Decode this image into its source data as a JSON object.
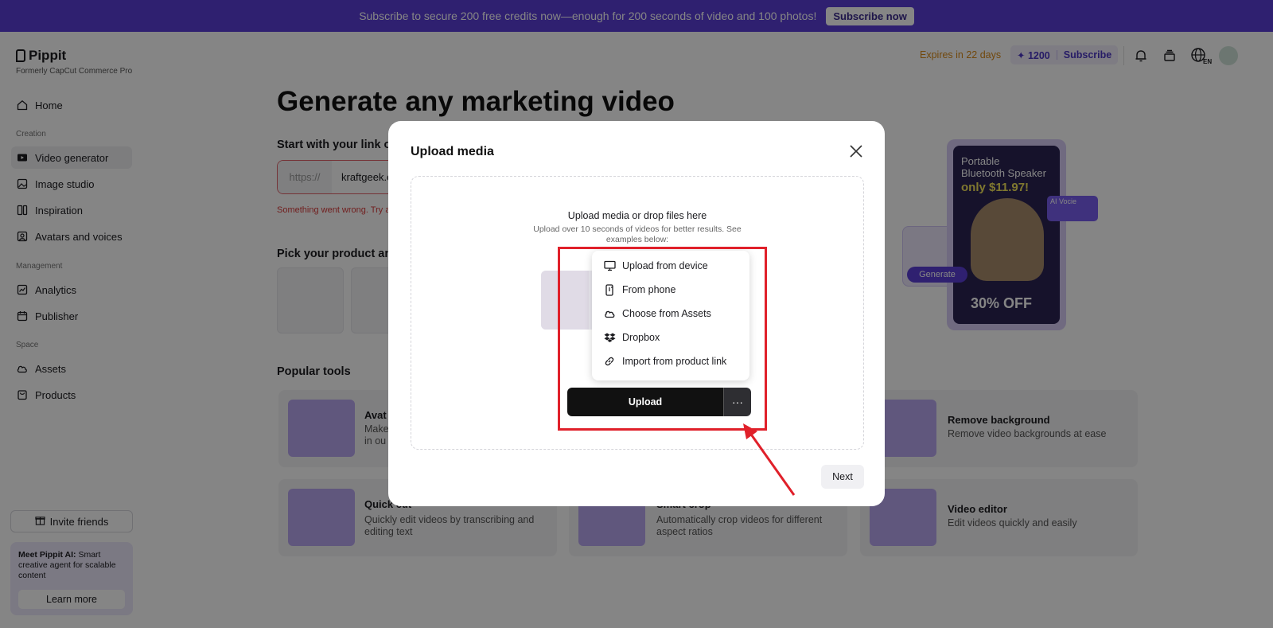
{
  "banner": {
    "text": "Subscribe to secure 200 free credits now—enough for 200 seconds of video and 100 photos!",
    "button": "Subscribe now"
  },
  "sidebar": {
    "logo": "Pippit",
    "logo_sub": "Formerly CapCut Commerce Pro",
    "home": "Home",
    "section_creation": "Creation",
    "creation_items": [
      {
        "label": "Video generator",
        "icon": "video-icon"
      },
      {
        "label": "Image studio",
        "icon": "image-icon"
      },
      {
        "label": "Inspiration",
        "icon": "inspiration-icon"
      },
      {
        "label": "Avatars and voices",
        "icon": "avatar-icon"
      }
    ],
    "section_management": "Management",
    "management_items": [
      {
        "label": "Analytics",
        "icon": "analytics-icon"
      },
      {
        "label": "Publisher",
        "icon": "publisher-icon"
      }
    ],
    "section_space": "Space",
    "space_items": [
      {
        "label": "Assets",
        "icon": "cloud-icon"
      },
      {
        "label": "Products",
        "icon": "bag-icon"
      }
    ],
    "invite": "Invite friends",
    "promo_title": "Meet Pippit AI:",
    "promo_text": " Smart creative agent for scalable content",
    "promo_button": "Learn more"
  },
  "header": {
    "expires": "Expires in 22 days",
    "credits": "✦ 1200",
    "subscribe": "Subscribe",
    "lang": "EN"
  },
  "main": {
    "title": "Generate any marketing video",
    "start_label": "Start with your link or",
    "url_prefix": "https://",
    "url_value": "kraftgeek.c",
    "error": "Something went wrong. Try a",
    "pick_label": "Pick your product and",
    "popular_label": "Popular tools",
    "tools": [
      {
        "title": "Avat",
        "desc": "Make\nin ou"
      },
      {
        "title": "Remove background",
        "desc": "Remove video backgrounds at ease"
      },
      {
        "title": "Quick cut",
        "desc": "Quickly edit videos by transcribing and editing text"
      },
      {
        "title": "Smart crop",
        "desc": "Automatically crop videos for different aspect ratios"
      },
      {
        "title": "Video editor",
        "desc": "Edit videos quickly and easily"
      }
    ]
  },
  "hero": {
    "line1": "Portable",
    "line2": "Bluetooth Speaker",
    "price": "only $11.97!",
    "off": "30% OFF",
    "generate": "Generate",
    "ai_voice": "AI Vocie"
  },
  "modal": {
    "title": "Upload media",
    "dz_title": "Upload media or drop files here",
    "dz_sub": "Upload over 10 seconds of videos for better results. See examples below:",
    "menu": [
      {
        "label": "Upload from device",
        "icon": "monitor-icon"
      },
      {
        "label": "From phone",
        "icon": "phone-icon"
      },
      {
        "label": "Choose from Assets",
        "icon": "cloud-icon"
      },
      {
        "label": "Dropbox",
        "icon": "dropbox-icon"
      },
      {
        "label": "Import from product link",
        "icon": "link-icon"
      }
    ],
    "upload": "Upload",
    "more": "···",
    "next": "Next"
  },
  "colors": {
    "accent": "#5b3fd6",
    "highlight": "#e0202a",
    "expire": "#d98a18"
  }
}
